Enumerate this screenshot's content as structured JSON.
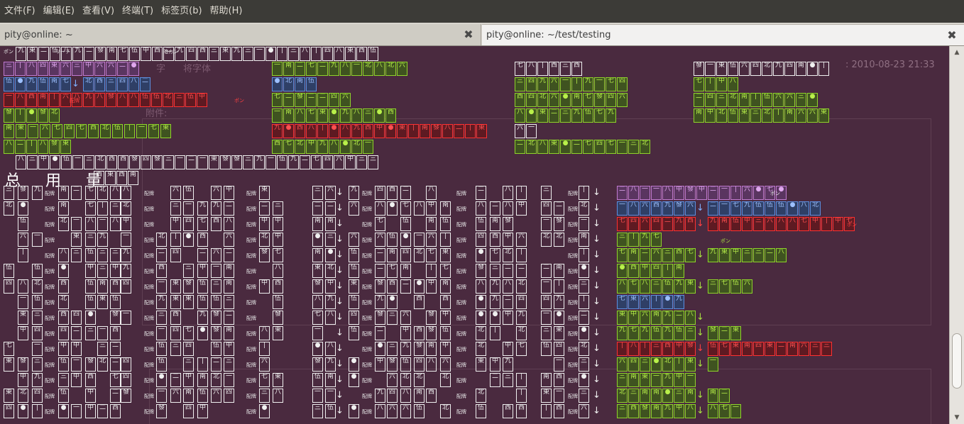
{
  "menubar": {
    "items": [
      "文件(F)",
      "编辑(E)",
      "查看(V)",
      "终端(T)",
      "标签页(b)",
      "帮助(H)"
    ]
  },
  "tabs": [
    {
      "title": "pity@online: ~",
      "active": false
    },
    {
      "title": "pity@online: ~/test/testing",
      "active": true
    }
  ],
  "terminal": {
    "ghost_texts": [
      "字",
      "将字体",
      "附件:"
    ],
    "ghost_date": ": 2010-08-23 21:33",
    "big_label": "总 用 量",
    "notes": {
      "pon": "ポン",
      "riichi": "リーチ",
      "ankan": "暗カン",
      "haipai": "配牌",
      "kakan": "加槓"
    },
    "row_labels": [
      "配牌"
    ],
    "accent_colors": {
      "green": "#8fd42a",
      "red": "#ff3030",
      "blue": "#5b8fe0",
      "purple": "#c07ad0",
      "white": "#f0f0f0",
      "background": "#4a2a3f"
    }
  },
  "scrollbar": {
    "up_icon": "▲",
    "down_icon": "▼"
  }
}
